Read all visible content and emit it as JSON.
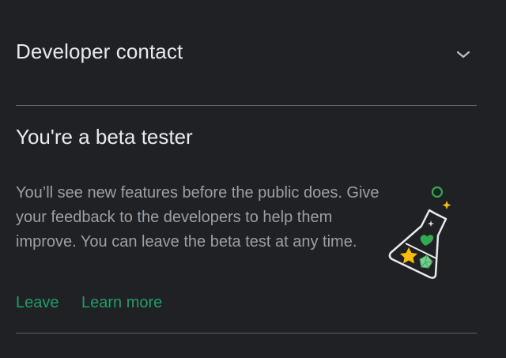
{
  "developer_contact": {
    "title": "Developer contact",
    "expand_icon": "chevron-down-icon"
  },
  "beta": {
    "title": "You're a beta tester",
    "description": "You’ll see new features before the public does. Give your feedback to the developers to help them improve. You can leave the beta test at any time.",
    "leave_label": "Leave",
    "learn_more_label": "Learn more",
    "illustration_icon": "beaker-icon"
  },
  "colors": {
    "background": "#202124",
    "primary_text": "#e8eaed",
    "secondary_text": "#9aa0a6",
    "accent": "#1e9e6a",
    "divider": "#5f6368"
  }
}
